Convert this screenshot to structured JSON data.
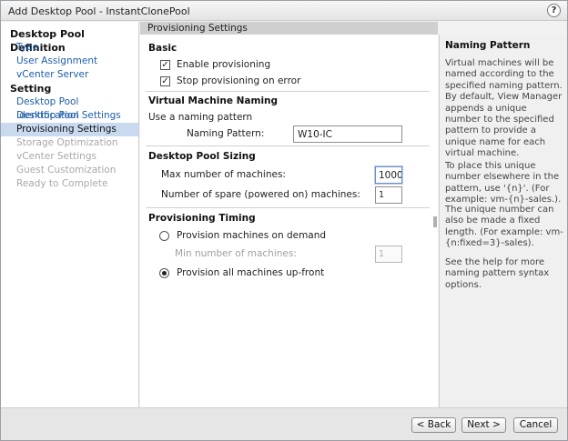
{
  "window": {
    "title": "Add Desktop Pool - InstantClonePool",
    "help_label": "?"
  },
  "nav": {
    "section1": "Desktop Pool Definition",
    "section1_items": [
      {
        "label": "Type",
        "state": "link"
      },
      {
        "label": "User Assignment",
        "state": "link"
      },
      {
        "label": "vCenter Server",
        "state": "link"
      }
    ],
    "section2": "Setting",
    "section2_items": [
      {
        "label": "Desktop Pool Identification",
        "state": "link"
      },
      {
        "label": "Desktop Pool Settings",
        "state": "link"
      },
      {
        "label": "Provisioning Settings",
        "state": "active"
      },
      {
        "label": "Storage Optimization",
        "state": "disabled"
      },
      {
        "label": "vCenter Settings",
        "state": "disabled"
      },
      {
        "label": "Guest Customization",
        "state": "disabled"
      },
      {
        "label": "Ready to Complete",
        "state": "disabled"
      }
    ]
  },
  "main": {
    "header": "Provisioning Settings",
    "basic": {
      "title": "Basic",
      "enable_label": "Enable provisioning",
      "enable_checked": true,
      "stop_label": "Stop provisioning on error",
      "stop_checked": true
    },
    "naming": {
      "title": "Virtual Machine Naming",
      "use_pattern_label": "Use a naming pattern",
      "pattern_label": "Naming Pattern:",
      "pattern_value": "W10-IC"
    },
    "sizing": {
      "title": "Desktop Pool Sizing",
      "max_label": "Max number of machines:",
      "max_value": "1000",
      "spare_label": "Number of spare (powered on) machines:",
      "spare_value": "1"
    },
    "timing": {
      "title": "Provisioning Timing",
      "on_demand_label": "Provision machines on demand",
      "min_label": "Min number of machines:",
      "min_value": "1",
      "all_upfront_label": "Provision all machines up-front",
      "selected": "all_upfront"
    }
  },
  "help": {
    "title": "Naming Pattern",
    "p1": "Virtual machines will be named according to the specified naming pattern. By default, View Manager appends a unique number to the specified pattern to provide a unique name for each virtual machine.",
    "p2": "To place this unique number elsewhere in the pattern, use '{n}'. (For example: vm-{n}-sales.).",
    "p3": "The unique number can also be made a fixed length. (For example: vm-{n:fixed=3}-sales).",
    "p4": "See the help for more naming pattern syntax options."
  },
  "footer": {
    "back_label": "< Back",
    "next_label": "Next >",
    "cancel_label": "Cancel"
  },
  "icons": {
    "help": "question-circle-icon",
    "checkbox_checked": "checkmark-icon",
    "radio": "radio-icon"
  }
}
